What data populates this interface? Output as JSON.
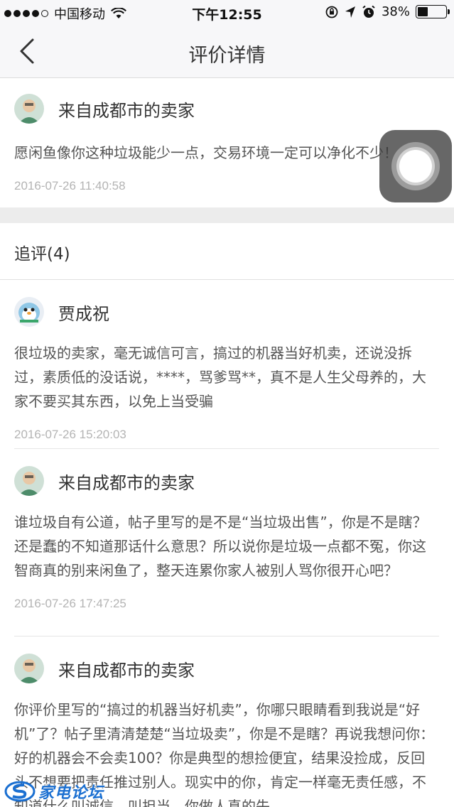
{
  "status_bar": {
    "carrier": "中国移动",
    "time": "下午12:55",
    "battery": "38%",
    "battery_level": 0.38
  },
  "nav": {
    "title": "评价详情"
  },
  "main_review": {
    "username": "来自成都市的卖家",
    "content": "愿闲鱼像你这种垃圾能少一点，交易环境一定可以净化不少！",
    "timestamp": "2016-07-26 11:40:58"
  },
  "followups": {
    "label": "追评(4)",
    "items": [
      {
        "username": "贾成祝",
        "content": "很垃圾的卖家，毫无诚信可言，搞过的机器当好机卖，还说没拆过，素质低的没话说，****，骂爹骂**，真不是人生父母养的，大家不要买其东西，以免上当受骗",
        "timestamp": "2016-07-26 15:20:03"
      },
      {
        "username": "来自成都市的卖家",
        "content": "谁垃圾自有公道，帖子里写的是不是“当垃圾出售”，你是不是瞎？还是蠢的不知道那话什么意思？所以说你是垃圾一点都不冤，你这智商真的别来闲鱼了，整天连累你家人被别人骂你很开心吧？",
        "timestamp": "2016-07-26 17:47:25"
      },
      {
        "username": "来自成都市的卖家",
        "content": "你评价里写的“搞过的机器当好机卖”，你哪只眼睛看到我说是“好机”了？帖子里清清楚楚“当垃圾卖”，你是不是瞎？再说我想问你：好的机器会不会卖100？你是典型的想捡便宜，结果没捡成，反回头不想要把责任推过别人。现实中的你，肯定一样毫无责任感，不知道什么叫诚信，叫担当，你做人真的失",
        "timestamp": ""
      }
    ]
  },
  "watermark": {
    "text": "家电论坛"
  }
}
